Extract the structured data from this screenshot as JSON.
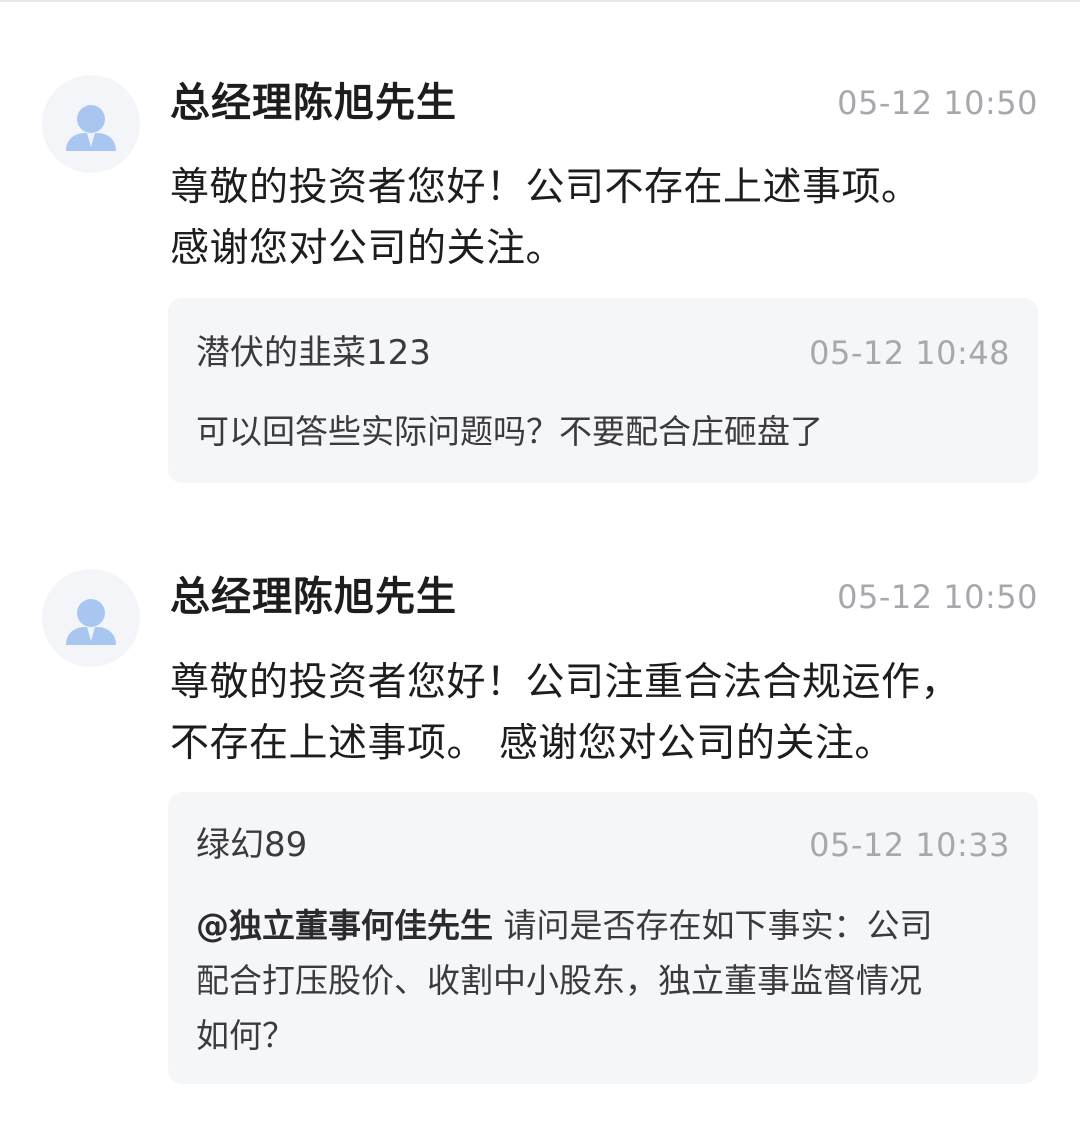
{
  "replies": [
    {
      "author": "总经理陈旭先生",
      "time": "05-12 10:50",
      "answer_lines": [
        "尊敬的投资者您好！公司不存在上述事项。",
        "感谢您对公司的关注。"
      ],
      "question": {
        "user": "潜伏的韭菜123",
        "time": "05-12 10:48",
        "mention": "",
        "text": "可以回答些实际问题吗？不要配合庄砸盘了"
      }
    },
    {
      "author": "总经理陈旭先生",
      "time": "05-12 10:50",
      "answer_lines": [
        "尊敬的投资者您好！公司注重合法合规运作，",
        "不存在上述事项。 感谢您对公司的关注。"
      ],
      "question": {
        "user": "绿幻89",
        "time": "05-12 10:33",
        "mention": "@独立董事何佳先生",
        "text_lines": [
          "请问是否存在如下事实：公司",
          "配合打压股价、收割中小股东，独立董事监督情况",
          "如何？"
        ]
      }
    }
  ],
  "colors": {
    "avatar_bg": "#f3f5f8",
    "avatar_figure": "#a9c6f0",
    "quote_bg": "#f5f6f8",
    "time_text": "#a6a8ad"
  },
  "icons": {
    "avatar": "user-avatar-icon"
  }
}
